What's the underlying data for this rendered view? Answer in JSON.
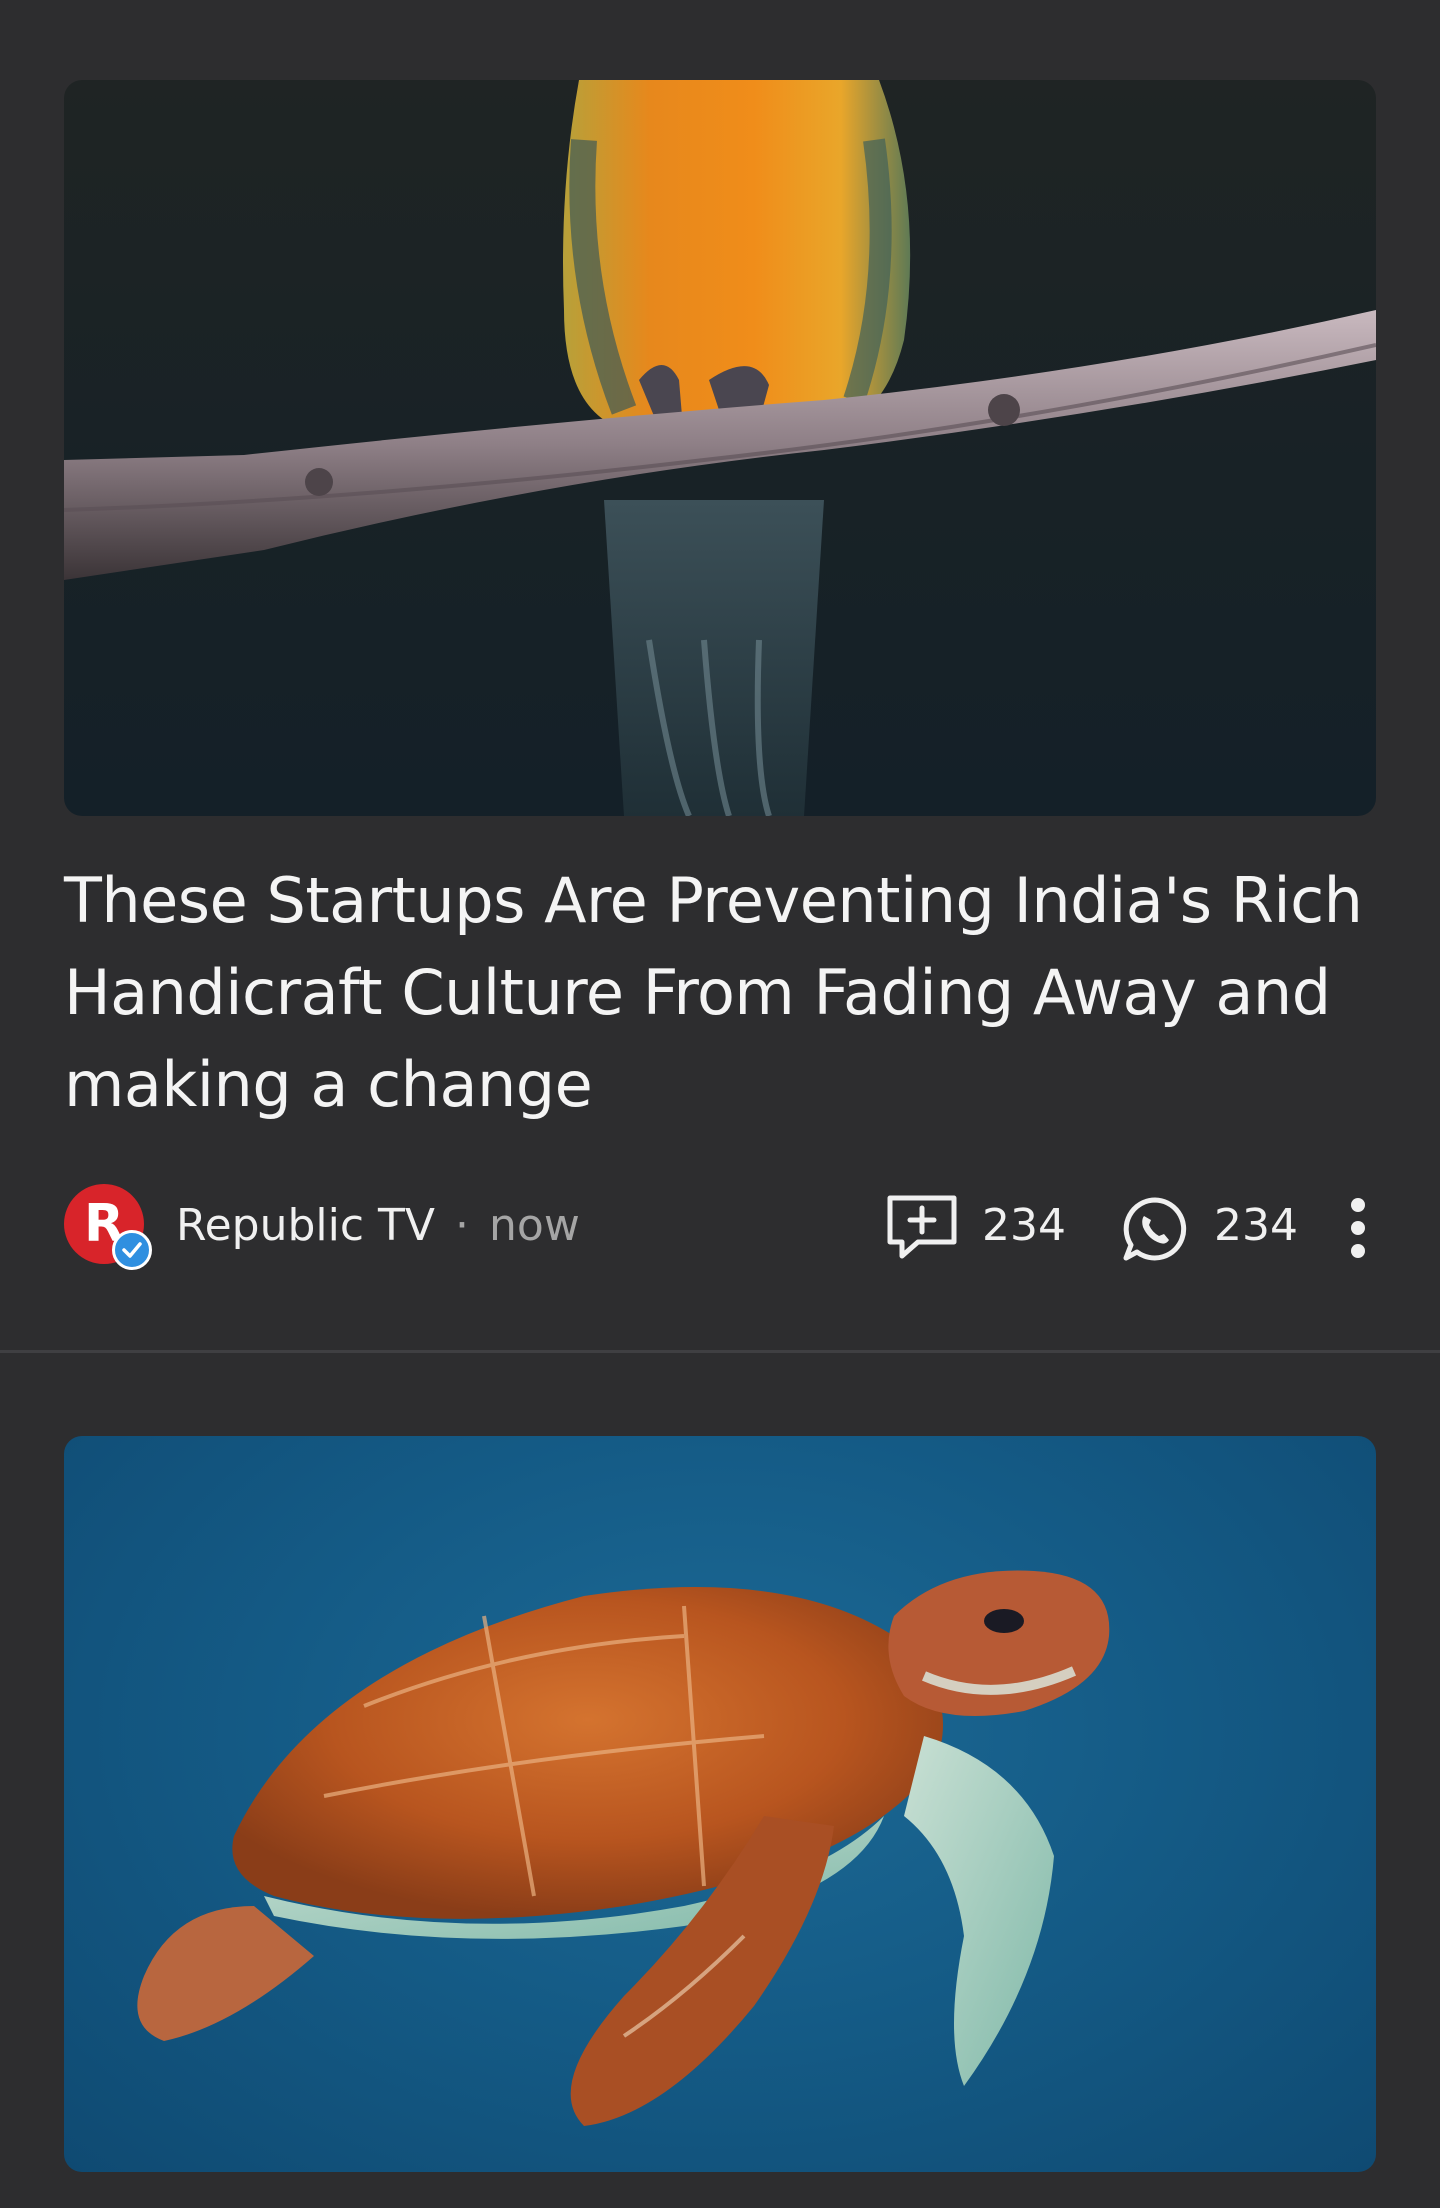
{
  "feed": {
    "articles": [
      {
        "image_subject": "orange parrot perched on a branch",
        "headline": "These Startups Are Preventing India's Rich Handicraft Culture From Fading Away and making a change",
        "publisher": {
          "avatar_letter": "R",
          "name": "Republic TV",
          "separator": "·",
          "time": "now",
          "verified": true
        },
        "stats": {
          "comments": "234",
          "shares": "234"
        }
      },
      {
        "image_subject": "sea turtle swimming in blue water"
      }
    ]
  },
  "icons": {
    "comment": "comment-add-icon",
    "share": "whatsapp-icon",
    "more": "more-vert-icon",
    "verified": "verified-check-icon"
  },
  "colors": {
    "background": "#2d2d2f",
    "avatar": "#d8242a",
    "verified_badge": "#2f8fe0",
    "secondary_text": "#a5a5a5"
  }
}
